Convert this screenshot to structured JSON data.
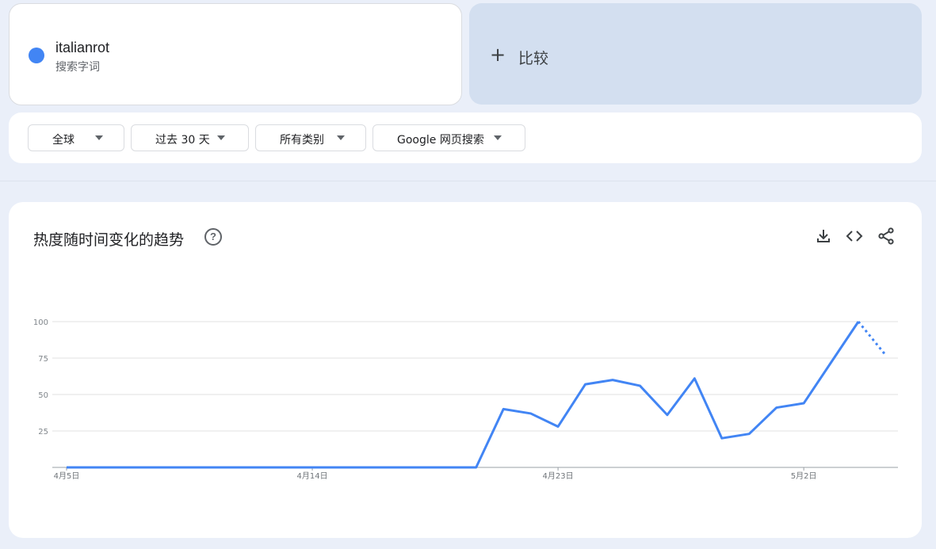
{
  "term": {
    "name": "italianrot",
    "type": "搜索字词",
    "color": "#4285f4"
  },
  "compare": {
    "icon": "plus-icon",
    "label": "比较"
  },
  "filters": [
    {
      "label": "全球"
    },
    {
      "label": "过去 30 天"
    },
    {
      "label": "所有类别"
    },
    {
      "label": "Google 网页搜索"
    }
  ],
  "chart": {
    "title": "热度随时间变化的趋势",
    "help_icon": "help-circle-icon",
    "actions": [
      "download-icon",
      "embed-code-icon",
      "share-icon"
    ]
  },
  "chart_data": {
    "type": "line",
    "title": "热度随时间变化的趋势",
    "xlabel": "",
    "ylabel": "",
    "x_ticks": [
      "4月5日",
      "4月14日",
      "4月23日",
      "5月2日"
    ],
    "y_ticks": [
      25,
      50,
      75,
      100
    ],
    "ylim": [
      0,
      100
    ],
    "grid": true,
    "line_color": "#4285f4",
    "x": [
      "4月5日",
      "4月6日",
      "4月7日",
      "4月8日",
      "4月9日",
      "4月10日",
      "4月11日",
      "4月12日",
      "4月13日",
      "4月14日",
      "4月15日",
      "4月16日",
      "4月17日",
      "4月18日",
      "4月19日",
      "4月20日",
      "4月21日",
      "4月22日",
      "4月23日",
      "4月24日",
      "4月25日",
      "4月26日",
      "4月27日",
      "4月28日",
      "4月29日",
      "4月30日",
      "5月1日",
      "5月2日",
      "5月3日",
      "5月4日",
      "5月5日"
    ],
    "values": [
      0,
      0,
      0,
      0,
      0,
      0,
      0,
      0,
      0,
      0,
      0,
      0,
      0,
      0,
      0,
      0,
      40,
      37,
      28,
      57,
      60,
      56,
      36,
      61,
      20,
      23,
      41,
      44,
      72,
      100,
      77
    ],
    "partial_from_index": 29
  }
}
